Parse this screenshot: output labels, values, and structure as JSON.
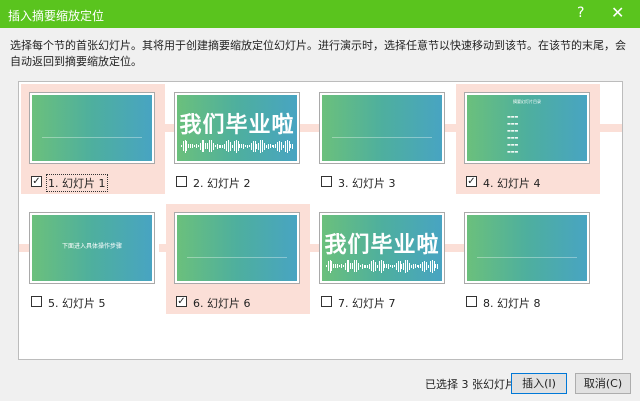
{
  "window": {
    "title": "插入摘要缩放定位",
    "help_glyph": "?",
    "close_glyph": "✕"
  },
  "description": "选择每个节的首张幻灯片。其将用于创建摘要缩放定位幻灯片。进行演示时，选择任意节以快速移动到该节。在该节的末尾，会自动返回到摘要缩放定位。",
  "slides": [
    {
      "label": "1. 幻灯片 1",
      "checked": true
    },
    {
      "label": "2. 幻灯片 2",
      "checked": false
    },
    {
      "label": "3. 幻灯片 3",
      "checked": false
    },
    {
      "label": "4. 幻灯片 4",
      "checked": true
    },
    {
      "label": "5. 幻灯片 5",
      "checked": false
    },
    {
      "label": "6. 幻灯片 6",
      "checked": true
    },
    {
      "label": "7. 幻灯片 7",
      "checked": false
    },
    {
      "label": "8. 幻灯片 8",
      "checked": false
    }
  ],
  "slide_content": {
    "big_title": "我们毕业啦",
    "slide4_heading": "摘要幻灯片目录",
    "slide5_text": "下面进入具体操作步骤"
  },
  "status": "已选择 3 张幻灯片",
  "buttons": {
    "insert": "插入(I)",
    "cancel": "取消(C)"
  },
  "colors": {
    "titlebar": "#5ac41e",
    "selection": "#fbdfd7",
    "slide_gradient_start": "#6bc07c",
    "slide_gradient_end": "#48a4c2"
  }
}
